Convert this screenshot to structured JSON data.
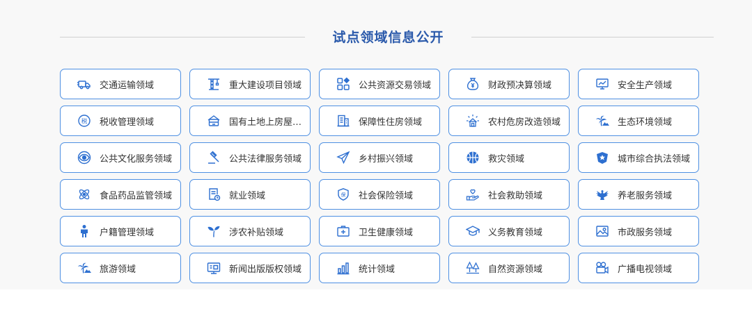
{
  "section": {
    "title": "试点领域信息公开"
  },
  "colors": {
    "accent": "#2b5aab",
    "border": "#4d8fe2",
    "icon": "#2d6fd0",
    "text": "#333333",
    "background": "#f8f8f8"
  },
  "tiles": [
    {
      "label": "交通运输领域",
      "icon": "truck-icon"
    },
    {
      "label": "重大建设项目领域",
      "icon": "crane-icon"
    },
    {
      "label": "公共资源交易领域",
      "icon": "grid-apps-icon"
    },
    {
      "label": "财政预决算领域",
      "icon": "money-bag-icon"
    },
    {
      "label": "安全生产领域",
      "icon": "monitor-chart-icon"
    },
    {
      "label": "税收管理领域",
      "icon": "tax-seal-icon"
    },
    {
      "label": "国有土地上房屋征...",
      "icon": "house-icon"
    },
    {
      "label": "保障性住房领域",
      "icon": "apartment-icon"
    },
    {
      "label": "农村危房改造领域",
      "icon": "sun-house-icon"
    },
    {
      "label": "生态环境领域",
      "icon": "palm-tree-icon"
    },
    {
      "label": "公共文化服务领域",
      "icon": "eye-circle-icon"
    },
    {
      "label": "公共法律服务领域",
      "icon": "gavel-icon"
    },
    {
      "label": "乡村振兴领域",
      "icon": "paper-plane-icon"
    },
    {
      "label": "救灾领域",
      "icon": "ball-icon"
    },
    {
      "label": "城市综合执法领域",
      "icon": "police-badge-icon"
    },
    {
      "label": "食品药品监管领域",
      "icon": "atom-icon"
    },
    {
      "label": "就业领域",
      "icon": "document-clock-icon"
    },
    {
      "label": "社会保险领域",
      "icon": "shield-icon"
    },
    {
      "label": "社会救助领域",
      "icon": "helping-hand-icon"
    },
    {
      "label": "养老服务领域",
      "icon": "eagle-icon"
    },
    {
      "label": "户籍管理领域",
      "icon": "person-icon"
    },
    {
      "label": "涉农补贴领域",
      "icon": "sprout-icon"
    },
    {
      "label": "卫生健康领域",
      "icon": "medical-kit-icon"
    },
    {
      "label": "义务教育领域",
      "icon": "graduation-cap-icon"
    },
    {
      "label": "市政服务领域",
      "icon": "picture-icon"
    },
    {
      "label": "旅游领域",
      "icon": "palm-tree-icon"
    },
    {
      "label": "新闻出版版权领域",
      "icon": "news-screen-icon"
    },
    {
      "label": "统计领域",
      "icon": "bar-chart-icon"
    },
    {
      "label": "自然资源领域",
      "icon": "trees-icon"
    },
    {
      "label": "广播电视领域",
      "icon": "camera-icon"
    }
  ]
}
